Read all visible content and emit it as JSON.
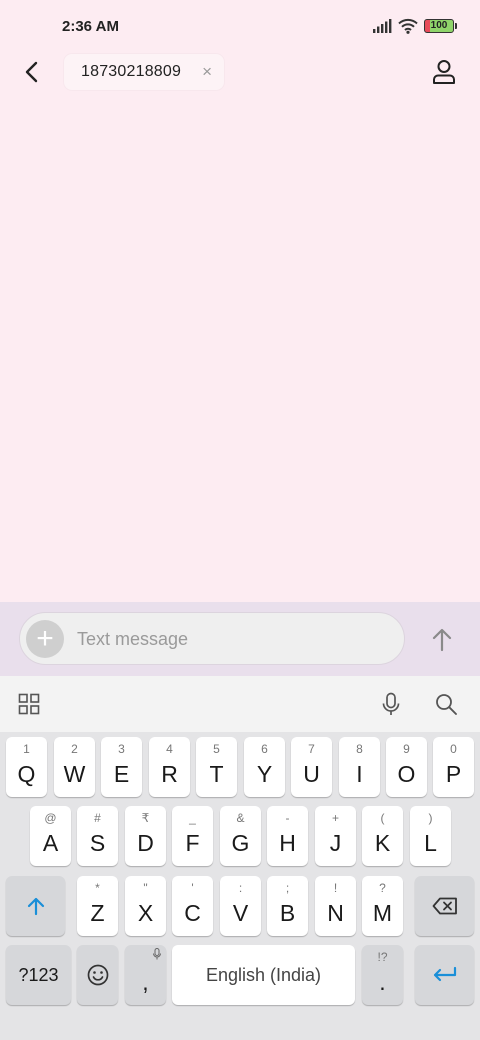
{
  "status_bar": {
    "time": "2:36 AM",
    "battery": "100"
  },
  "header": {
    "recipient": "18730218809",
    "chip_close": "×"
  },
  "compose": {
    "placeholder": "Text message",
    "attach_glyph": "+"
  },
  "keyboard": {
    "row1": [
      {
        "l": "Q",
        "h": "1"
      },
      {
        "l": "W",
        "h": "2"
      },
      {
        "l": "E",
        "h": "3"
      },
      {
        "l": "R",
        "h": "4"
      },
      {
        "l": "T",
        "h": "5"
      },
      {
        "l": "Y",
        "h": "6"
      },
      {
        "l": "U",
        "h": "7"
      },
      {
        "l": "I",
        "h": "8"
      },
      {
        "l": "O",
        "h": "9"
      },
      {
        "l": "P",
        "h": "0"
      }
    ],
    "row2": [
      {
        "l": "A",
        "h": "@"
      },
      {
        "l": "S",
        "h": "#"
      },
      {
        "l": "D",
        "h": "₹"
      },
      {
        "l": "F",
        "h": "_"
      },
      {
        "l": "G",
        "h": "&"
      },
      {
        "l": "H",
        "h": "-"
      },
      {
        "l": "J",
        "h": "+"
      },
      {
        "l": "K",
        "h": "("
      },
      {
        "l": "L",
        "h": ")"
      }
    ],
    "row3": [
      {
        "l": "Z",
        "h": "*"
      },
      {
        "l": "X",
        "h": "\""
      },
      {
        "l": "C",
        "h": "'"
      },
      {
        "l": "V",
        "h": ":"
      },
      {
        "l": "B",
        "h": ";"
      },
      {
        "l": "N",
        "h": "!"
      },
      {
        "l": "M",
        "h": "?"
      }
    ],
    "symbols_key": "?123",
    "comma_key": ",",
    "space_key": "English (India)",
    "period_key": ".",
    "period_hint": "!?"
  },
  "colors": {
    "background": "#fdecf2",
    "compose_bg": "#e9dfec",
    "accent": "#1a8fd8"
  },
  "icons": {
    "back": "back-arrow-icon",
    "contact": "person-icon",
    "send": "arrow-up-icon",
    "apps": "grid-icon",
    "mic": "microphone-icon",
    "search": "search-icon",
    "shift": "shift-arrow-icon",
    "backspace": "backspace-icon",
    "emoji": "emoji-icon",
    "enter": "enter-icon"
  }
}
